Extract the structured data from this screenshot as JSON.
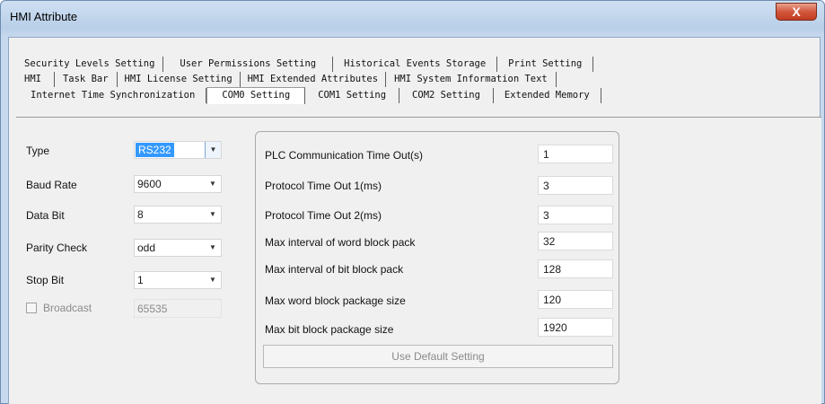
{
  "window": {
    "title": "HMI Attribute",
    "close_glyph": "X"
  },
  "tab_rows": [
    [
      "Security Levels Setting",
      "User Permissions Setting",
      "Historical Events Storage",
      "Print Setting"
    ],
    [
      "HMI",
      "Task Bar",
      "HMI License Setting",
      "HMI Extended Attributes",
      "HMI System Information Text"
    ],
    [
      "Internet Time Synchronization",
      "COM0 Setting",
      "COM1 Setting",
      "COM2 Setting",
      "Extended Memory"
    ]
  ],
  "active_tab": "COM0 Setting",
  "left": {
    "type": {
      "label": "Type",
      "value": "RS232"
    },
    "baud": {
      "label": "Baud Rate",
      "value": "9600"
    },
    "databit": {
      "label": "Data Bit",
      "value": "8"
    },
    "parity": {
      "label": "Parity Check",
      "value": "odd"
    },
    "stopbit": {
      "label": "Stop Bit",
      "value": "1"
    },
    "broadcast": {
      "label": "Broadcast",
      "value": "65535",
      "checked": false
    }
  },
  "right": {
    "fields": [
      {
        "label": "PLC Communication Time Out(s)",
        "value": "1"
      },
      {
        "label": "Protocol Time Out 1(ms)",
        "value": "3"
      },
      {
        "label": "Protocol Time Out 2(ms)",
        "value": "3"
      },
      {
        "label": "Max interval of word block pack",
        "value": "32"
      },
      {
        "label": "Max interval of bit block pack",
        "value": "128"
      },
      {
        "label": "Max word block package size",
        "value": "120"
      },
      {
        "label": "Max bit block package size",
        "value": "1920"
      }
    ],
    "default_button": "Use Default Setting"
  },
  "icons": {
    "dropdown_arrow": "▼"
  }
}
